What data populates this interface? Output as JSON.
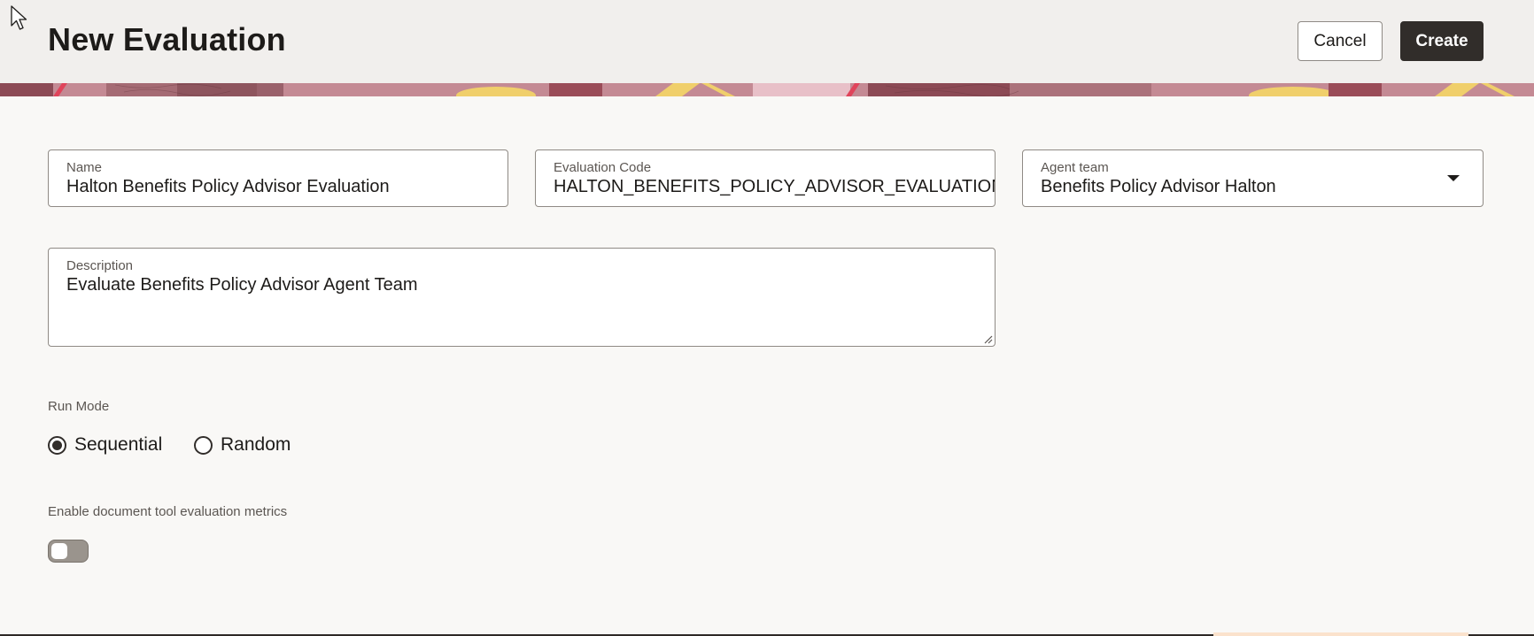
{
  "header": {
    "title": "New Evaluation",
    "cancel_label": "Cancel",
    "create_label": "Create"
  },
  "form": {
    "name": {
      "label": "Name",
      "value": "Halton Benefits Policy Advisor Evaluation"
    },
    "code": {
      "label": "Evaluation Code",
      "value": "HALTON_BENEFITS_POLICY_ADVISOR_EVALUATION"
    },
    "team": {
      "label": "Agent team",
      "value": "Benefits Policy Advisor Halton",
      "icon": "chevron-down-icon"
    },
    "description": {
      "label": "Description",
      "value": "Evaluate Benefits Policy Advisor Agent Team"
    },
    "run_mode": {
      "label": "Run Mode",
      "options": [
        "Sequential",
        "Random"
      ],
      "selected": "Sequential"
    },
    "doc_metrics": {
      "label": "Enable document tool evaluation metrics",
      "enabled": false
    }
  },
  "colors": {
    "primary_button": "#312d2a",
    "header_bg": "#f1efed",
    "page_bg": "#f9f8f6",
    "banner_base": "#c48a94",
    "banner_accent": "#f0cf6b"
  }
}
